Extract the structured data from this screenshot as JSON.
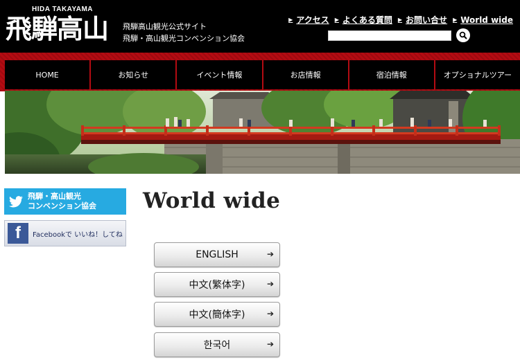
{
  "header": {
    "logo_en": "HIDA TAKAYAMA",
    "logo_jp": "飛騨高山",
    "site_line1": "飛騨高山観光公式サイト",
    "site_line2": "飛騨・高山観光コンベンション協会",
    "util_links": [
      "アクセス",
      "よくある質問",
      "お問い合せ",
      "World wide"
    ],
    "search_placeholder": ""
  },
  "nav": {
    "items": [
      "HOME",
      "お知らせ",
      "イベント情報",
      "お店情報",
      "宿泊情報",
      "オプショナルツアー"
    ]
  },
  "sidebar": {
    "twitter_line1": "飛騨・高山観光",
    "twitter_line2": "コンベンション協会",
    "facebook_label": "Facebookで いいね！してね"
  },
  "main": {
    "title": "World wide",
    "languages": [
      "ENGLISH",
      "中文(繁体字)",
      "中文(簡体字)",
      "한국어"
    ]
  },
  "colors": {
    "header_bg": "#000000",
    "nav_red": "#b40b12",
    "twitter_blue": "#27aae1",
    "facebook_blue": "#3b5998"
  }
}
